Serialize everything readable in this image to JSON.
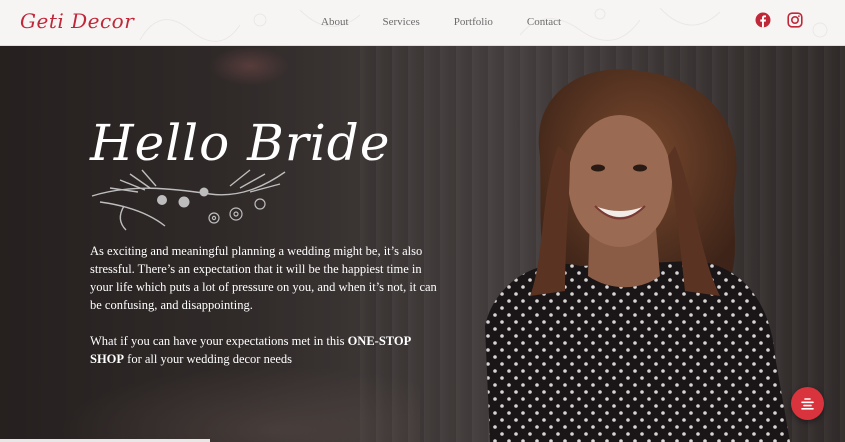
{
  "header": {
    "logo_text": "Geti Decor",
    "nav": [
      "About",
      "Services",
      "Portfolio",
      "Contact"
    ],
    "social_icons": [
      "facebook-icon",
      "instagram-icon"
    ]
  },
  "hero": {
    "headline": "Hello Bride",
    "paragraph1": "As exciting and meaningful planning a wedding might be, it’s also stressful. There’s an expectation that it will be the happiest time in your life which puts a lot of pressure on you, and when it’s not, it can be confusing, and disappointing.",
    "paragraph2_start": "What if you can have your expectations met in this ",
    "paragraph2_bold": "ONE-STOP SHOP",
    "paragraph2_end": " for all your wedding decor needs"
  },
  "fab": {
    "icon": "menu-lines-icon"
  },
  "colors": {
    "brand": "#c0283a",
    "fab": "#d9343d"
  }
}
